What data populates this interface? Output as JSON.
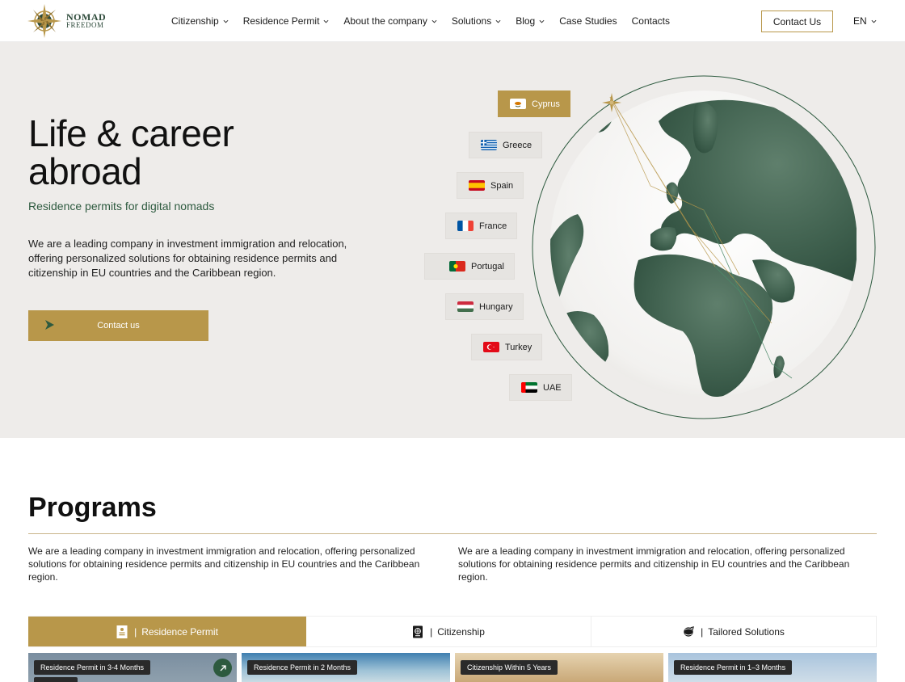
{
  "brand": {
    "name_line1": "NOMAD",
    "name_line2": "FREEDOM"
  },
  "nav": {
    "items": [
      {
        "label": "Citizenship",
        "dropdown": true
      },
      {
        "label": "Residence Permit",
        "dropdown": true
      },
      {
        "label": "About the company",
        "dropdown": true
      },
      {
        "label": "Solutions",
        "dropdown": true
      },
      {
        "label": "Blog",
        "dropdown": true
      },
      {
        "label": "Case Studies",
        "dropdown": false
      },
      {
        "label": "Contacts",
        "dropdown": false
      }
    ],
    "contact_button": "Contact Us",
    "language": "EN"
  },
  "hero": {
    "title": "Life & career\nabroad",
    "subtitle": "Residence permits for digital nomads",
    "description": "We are a leading company in investment immigration and relocation, offering personalized solutions for obtaining residence permits and citizenship in EU countries and the Caribbean region.",
    "cta": "Contact us",
    "countries": [
      {
        "name": "Cyprus",
        "active": true
      },
      {
        "name": "Greece",
        "active": false
      },
      {
        "name": "Spain",
        "active": false
      },
      {
        "name": "France",
        "active": false
      },
      {
        "name": "Portugal",
        "active": false
      },
      {
        "name": "Hungary",
        "active": false
      },
      {
        "name": "Turkey",
        "active": false
      },
      {
        "name": "UAE",
        "active": false
      }
    ]
  },
  "programs": {
    "title": "Programs",
    "description_left": "We are a leading company in investment immigration and relocation, offering personalized solutions for obtaining residence permits and citizenship in EU countries and the Caribbean region.",
    "description_right": "We are a leading company in investment immigration and relocation, offering personalized solutions for obtaining residence permits and citizenship in EU countries and the Caribbean region.",
    "tabs": [
      {
        "label": "Residence Permit",
        "active": true
      },
      {
        "label": "Citizenship",
        "active": false
      },
      {
        "label": "Tailored Solutions",
        "active": false
      }
    ],
    "tab_separator": "|",
    "cards": [
      {
        "badge": "Residence Permit in 3-4 Months"
      },
      {
        "badge": "Residence Permit in 2 Months"
      },
      {
        "badge": "Citizenship Within 5 Years"
      },
      {
        "badge": "Residence Permit in 1–3 Months"
      }
    ]
  },
  "colors": {
    "gold": "#b8974a",
    "green": "#2d5a3f",
    "hero_bg": "#eeecea"
  }
}
